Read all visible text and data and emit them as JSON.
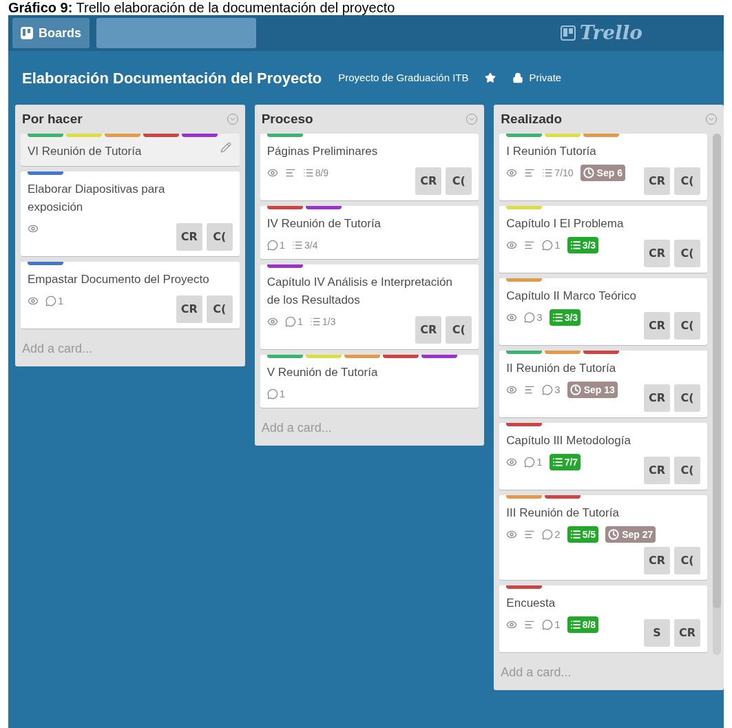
{
  "caption": "**Gráfico 9:** Trello elaboración de la documentación del proyecto",
  "topbar": {
    "boards_button": "Boards",
    "logo": "Trello"
  },
  "board": {
    "title": "Elaboración Documentación del Proyecto",
    "team": "Proyecto de Graduación ITB",
    "starred": false,
    "visibility": "Private"
  },
  "lists": [
    {
      "name": "Por hacer",
      "add_card": "Add a card...",
      "cards": [
        {
          "labels": [
            {
              "color": "#3cb371"
            },
            {
              "color": "#dddd44"
            },
            {
              "color": "#e39a4a"
            },
            {
              "color": "#cc4444"
            },
            {
              "color": "#9933cc"
            }
          ],
          "title": "VI Reunión de Tutoría",
          "hovered": true
        },
        {
          "labels": [
            {
              "color": "#4477cc"
            }
          ],
          "title": "Elaborar Diapositivas para exposición",
          "hovered": false,
          "badges": [
            {
              "kind": "watch"
            }
          ],
          "members": [
            "CR",
            "C("
          ]
        },
        {
          "labels": [
            {
              "color": "#4477cc"
            }
          ],
          "title": "Empastar Documento del Proyecto",
          "hovered": false,
          "badges": [
            {
              "kind": "watch"
            },
            {
              "kind": "comments",
              "text": "1"
            }
          ],
          "members": [
            "CR",
            "C("
          ]
        }
      ]
    },
    {
      "name": "Proceso",
      "add_card": "Add a card...",
      "cards": [
        {
          "labels": [
            {
              "color": "#3cb371"
            }
          ],
          "title": "Páginas Preliminares",
          "hovered": false,
          "badges": [
            {
              "kind": "watch"
            },
            {
              "kind": "description"
            },
            {
              "kind": "checklist",
              "text": "8/9",
              "complete": false
            }
          ],
          "members": [
            "CR",
            "C("
          ]
        },
        {
          "labels": [
            {
              "color": "#cc4444"
            },
            {
              "color": "#9933cc"
            }
          ],
          "title": "IV Reunión de Tutoría",
          "hovered": false,
          "badges": [
            {
              "kind": "comments",
              "text": "1"
            },
            {
              "kind": "checklist",
              "text": "3/4",
              "complete": false
            }
          ]
        },
        {
          "labels": [
            {
              "color": "#9933cc"
            }
          ],
          "title": "Capítulo IV Análisis e Interpretación de los Resultados",
          "hovered": false,
          "badges": [
            {
              "kind": "watch"
            },
            {
              "kind": "comments",
              "text": "1"
            },
            {
              "kind": "checklist",
              "text": "1/3",
              "complete": false
            }
          ],
          "members": [
            "CR",
            "C("
          ]
        },
        {
          "labels": [
            {
              "color": "#3cb371"
            },
            {
              "color": "#dddd44"
            },
            {
              "color": "#e39a4a"
            },
            {
              "color": "#cc4444"
            },
            {
              "color": "#9933cc"
            }
          ],
          "title": "V Reunión de Tutoría",
          "hovered": false,
          "badges": [
            {
              "kind": "comments",
              "text": "1"
            }
          ]
        }
      ]
    },
    {
      "name": "Realizado",
      "add_card": "Add a card...",
      "cards": [
        {
          "labels": [
            {
              "color": "#3cb371"
            },
            {
              "color": "#dddd44"
            },
            {
              "color": "#e39a4a"
            }
          ],
          "title": "I Reunión Tutoría",
          "hovered": false,
          "badges": [
            {
              "kind": "watch"
            },
            {
              "kind": "description"
            },
            {
              "kind": "checklist",
              "text": "7/10",
              "complete": false
            },
            {
              "kind": "due",
              "text": "Sep 6"
            }
          ],
          "members": [
            "CR",
            "C("
          ]
        },
        {
          "labels": [
            {
              "color": "#dddd44"
            }
          ],
          "title": "Capítulo I El Problema",
          "hovered": false,
          "badges": [
            {
              "kind": "watch"
            },
            {
              "kind": "description"
            },
            {
              "kind": "comments",
              "text": "1"
            },
            {
              "kind": "checklist",
              "text": "3/3",
              "complete": true
            }
          ],
          "members": [
            "CR",
            "C("
          ]
        },
        {
          "labels": [
            {
              "color": "#e39a4a"
            }
          ],
          "title": "Capítulo II Marco Teórico",
          "hovered": false,
          "badges": [
            {
              "kind": "watch"
            },
            {
              "kind": "comments",
              "text": "3"
            },
            {
              "kind": "checklist",
              "text": "3/3",
              "complete": true
            }
          ],
          "members": [
            "CR",
            "C("
          ]
        },
        {
          "labels": [
            {
              "color": "#3cb371"
            },
            {
              "color": "#e39a4a"
            },
            {
              "color": "#cc4444"
            }
          ],
          "title": "II Reunión de Tutoría",
          "hovered": false,
          "badges": [
            {
              "kind": "watch"
            },
            {
              "kind": "description"
            },
            {
              "kind": "comments",
              "text": "3"
            },
            {
              "kind": "due",
              "text": "Sep 13"
            }
          ],
          "members": [
            "CR",
            "C("
          ]
        },
        {
          "labels": [
            {
              "color": "#cc4444"
            }
          ],
          "title": "Capítulo III Metodología",
          "hovered": false,
          "badges": [
            {
              "kind": "watch"
            },
            {
              "kind": "comments",
              "text": "1"
            },
            {
              "kind": "checklist",
              "text": "7/7",
              "complete": true
            }
          ],
          "members": [
            "CR",
            "C("
          ]
        },
        {
          "labels": [
            {
              "color": "#e39a4a"
            },
            {
              "color": "#cc4444"
            }
          ],
          "title": "III Reunión de Tutoría",
          "hovered": false,
          "badges": [
            {
              "kind": "watch"
            },
            {
              "kind": "description"
            },
            {
              "kind": "comments",
              "text": "2"
            },
            {
              "kind": "checklist",
              "text": "5/5",
              "complete": true
            },
            {
              "kind": "due",
              "text": "Sep 27"
            }
          ],
          "members": [
            "CR",
            "C("
          ]
        },
        {
          "labels": [
            {
              "color": "#cc4444"
            }
          ],
          "title": "Encuesta",
          "hovered": false,
          "badges": [
            {
              "kind": "watch"
            },
            {
              "kind": "description"
            },
            {
              "kind": "comments",
              "text": "1"
            },
            {
              "kind": "checklist",
              "text": "8/8",
              "complete": true
            }
          ],
          "members": [
            "S",
            "CR"
          ]
        }
      ]
    }
  ]
}
